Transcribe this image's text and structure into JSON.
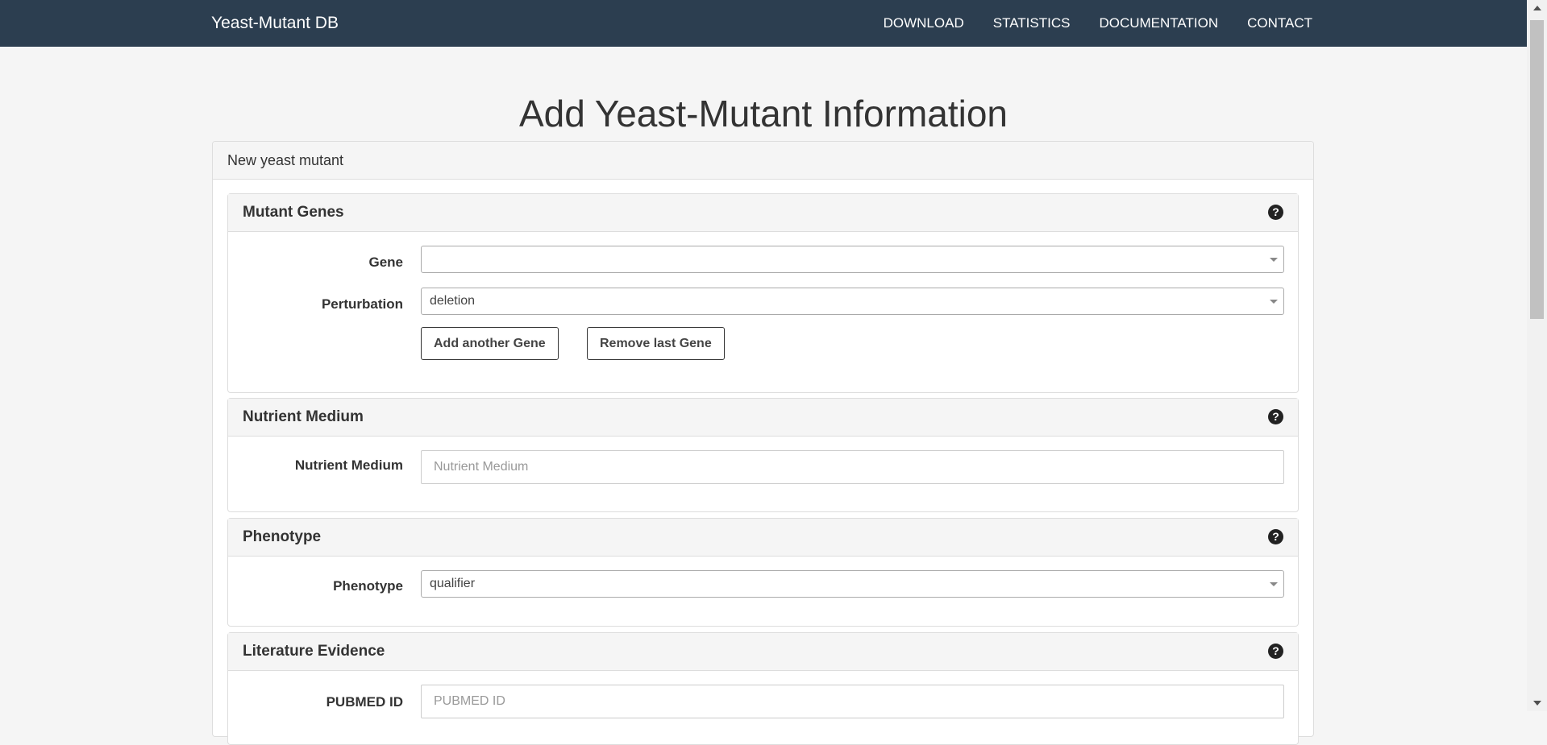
{
  "nav": {
    "brand": "Yeast-Mutant DB",
    "links": [
      "DOWNLOAD",
      "STATISTICS",
      "DOCUMENTATION",
      "CONTACT"
    ],
    "bg_color": "#2c3e50"
  },
  "page": {
    "title": "Add Yeast-Mutant Information"
  },
  "panel": {
    "heading": "New yeast mutant"
  },
  "sections": {
    "mutant_genes": {
      "title": "Mutant Genes",
      "help_icon": "question-circle-icon",
      "gene_label": "Gene",
      "gene_value": "",
      "perturbation_label": "Perturbation",
      "perturbation_value": "deletion",
      "add_button": "Add another Gene",
      "remove_button": "Remove last Gene"
    },
    "nutrient_medium": {
      "title": "Nutrient Medium",
      "help_icon": "question-circle-icon",
      "label": "Nutrient Medium",
      "placeholder": "Nutrient Medium"
    },
    "phenotype": {
      "title": "Phenotype",
      "help_icon": "question-circle-icon",
      "label": "Phenotype",
      "value": "qualifier"
    },
    "literature": {
      "title": "Literature Evidence",
      "help_icon": "question-circle-icon",
      "pubmed_label": "PUBMED ID",
      "pubmed_placeholder": "PUBMED ID"
    }
  }
}
